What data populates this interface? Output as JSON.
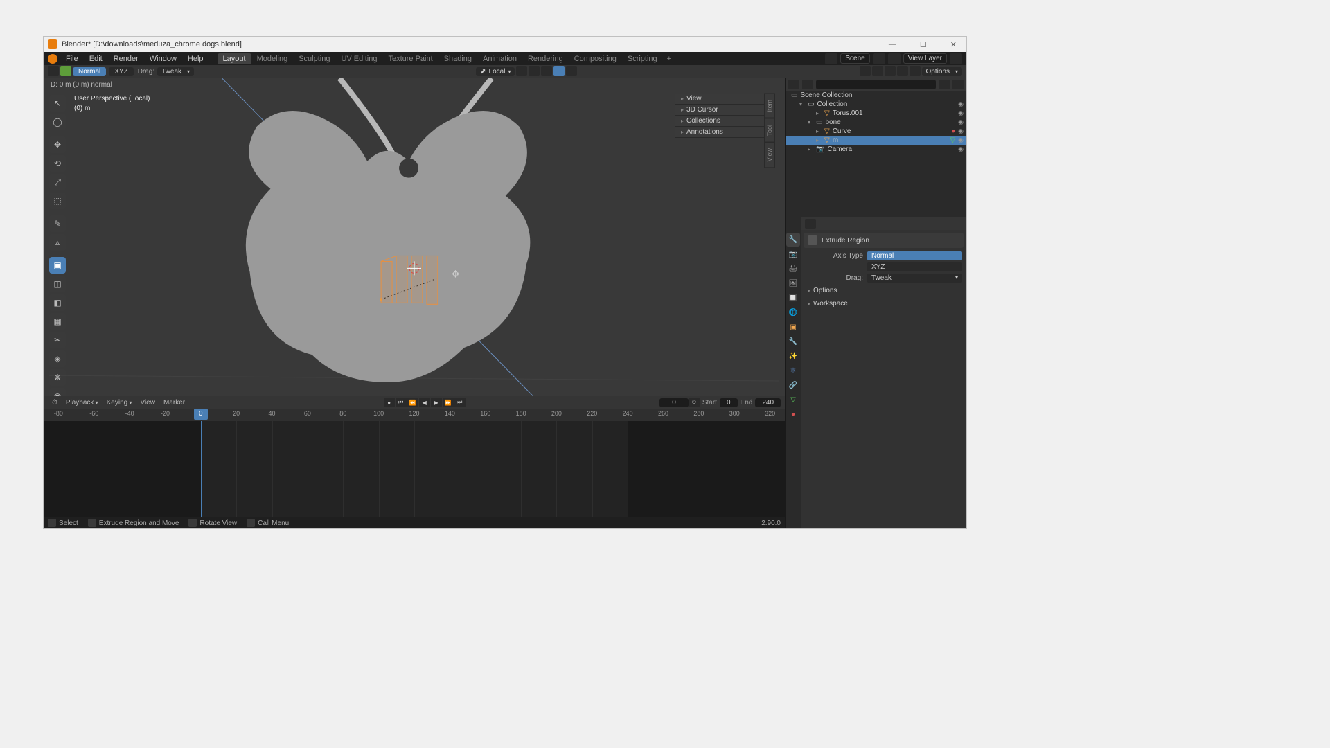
{
  "window": {
    "title": "Blender* [D:\\downloads\\meduza_chrome dogs.blend]"
  },
  "menubar": {
    "items": [
      "File",
      "Edit",
      "Render",
      "Window",
      "Help"
    ],
    "workspaces": [
      "Layout",
      "Modeling",
      "Sculpting",
      "UV Editing",
      "Texture Paint",
      "Shading",
      "Animation",
      "Rendering",
      "Compositing",
      "Scripting"
    ],
    "active_workspace": "Layout",
    "scene": "Scene",
    "view_layer": "View Layer"
  },
  "tool_header": {
    "normal": "Normal",
    "xyz": "XYZ",
    "drag_label": "Drag:",
    "drag_value": "Tweak",
    "orientation": "Local",
    "options": "Options"
  },
  "viewport": {
    "hint": "D: 0 m (0 m) normal",
    "perspective": "User Perspective (Local)",
    "object": "(0) m",
    "npanel": [
      "View",
      "3D Cursor",
      "Collections",
      "Annotations"
    ],
    "npanel_tabs": [
      "Item",
      "Tool",
      "View"
    ]
  },
  "timeline": {
    "menus": {
      "playback": "Playback",
      "keying": "Keying",
      "view": "View",
      "marker": "Marker"
    },
    "current_frame": "0",
    "start_label": "Start",
    "start": "0",
    "end_label": "End",
    "end": "240",
    "ticks": [
      "-80",
      "-60",
      "-40",
      "-20",
      "0",
      "20",
      "40",
      "60",
      "80",
      "100",
      "120",
      "140",
      "160",
      "180",
      "200",
      "220",
      "240",
      "260",
      "280",
      "300",
      "320"
    ]
  },
  "statusbar": {
    "select": "Select",
    "extrude": "Extrude Region and Move",
    "rotate": "Rotate View",
    "menu": "Call Menu",
    "version": "2.90.0"
  },
  "outliner": {
    "root": "Scene Collection",
    "collection": "Collection",
    "items": [
      {
        "name": "Torus.001",
        "type": "mesh",
        "indent": 3
      },
      {
        "name": "bone",
        "type": "collection",
        "indent": 2
      },
      {
        "name": "Curve",
        "type": "curve",
        "indent": 3
      },
      {
        "name": "m",
        "type": "mesh",
        "indent": 3,
        "selected": true
      },
      {
        "name": "Camera",
        "type": "camera",
        "indent": 2
      }
    ]
  },
  "properties": {
    "breadcrumb": "Extrude Region",
    "axis_label": "Axis Type",
    "axis_normal": "Normal",
    "axis_xyz": "XYZ",
    "drag_label": "Drag:",
    "drag_value": "Tweak",
    "sections": [
      "Options",
      "Workspace"
    ]
  }
}
